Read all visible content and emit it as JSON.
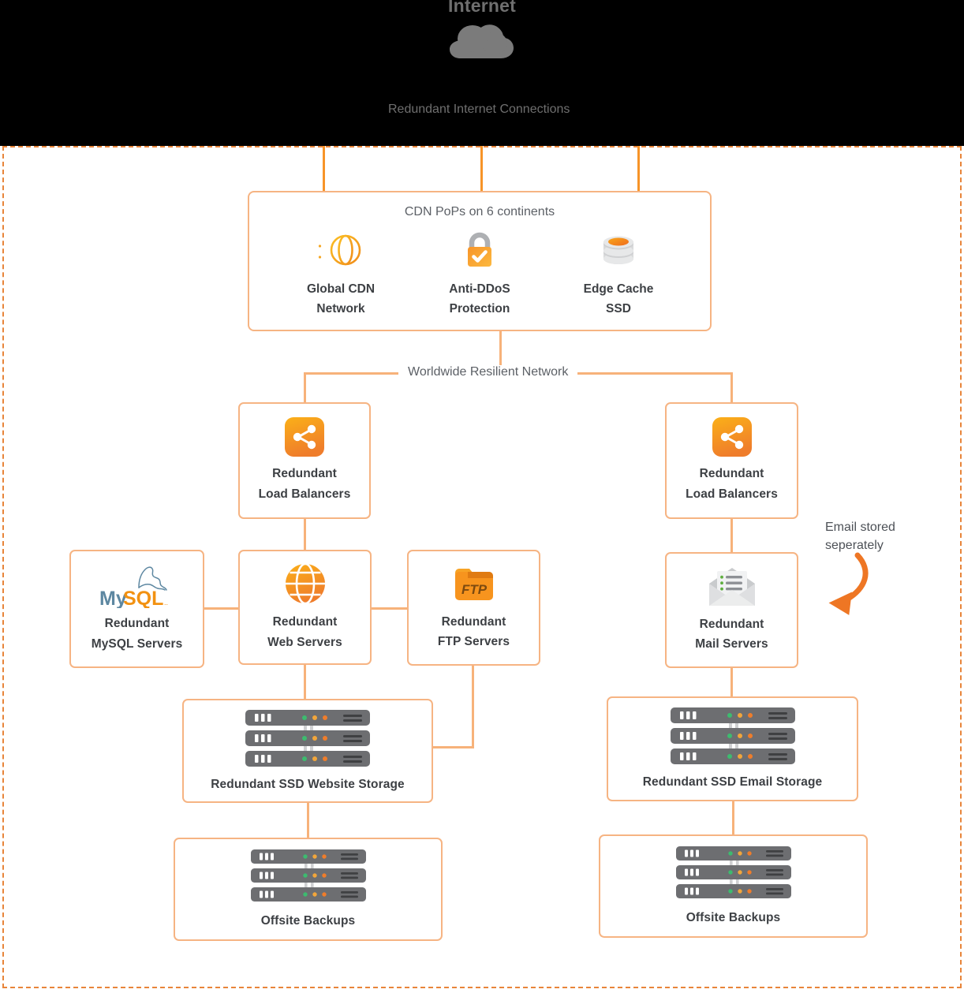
{
  "diagram": {
    "title": "Internet",
    "cloud_icon": "cloud-icon",
    "internet_link_label": "Redundant Internet Connections",
    "network_label": "Worldwide Resilient Network",
    "annotation": {
      "line1": "Email stored",
      "line2": "seperately"
    },
    "colors": {
      "accent": "#f79428",
      "line": "#f7b483",
      "box_border": "#f6b483",
      "band": "#000000",
      "text_dark": "#3d4044",
      "text_muted": "#5c6066",
      "rack_body": "#6d6e71",
      "led_green": "#3dbb6f",
      "led_orange": "#f2a63b",
      "led_red_orange": "#ef7d2b",
      "mysql_blue": "#5d87a1",
      "mysql_orange": "#f29111"
    }
  },
  "cdn_panel": {
    "title": "CDN PoPs on 6 continents",
    "items": [
      {
        "icon": "globe-speed-icon",
        "line1": "Global CDN",
        "line2": "Network"
      },
      {
        "icon": "lock-check-icon",
        "line1": "Anti-DDoS",
        "line2": "Protection"
      },
      {
        "icon": "database-icon",
        "line1": "Edge Cache",
        "line2": "SSD"
      }
    ]
  },
  "nodes": {
    "lb_left": {
      "icon": "share-nodes-icon",
      "line1": "Redundant",
      "line2": "Load Balancers"
    },
    "lb_right": {
      "icon": "share-nodes-icon",
      "line1": "Redundant",
      "line2": "Load Balancers"
    },
    "mysql": {
      "icon": "mysql-logo-icon",
      "line1": "Redundant",
      "line2": "MySQL Servers"
    },
    "web": {
      "icon": "globe-icon",
      "line1": "Redundant",
      "line2": "Web Servers"
    },
    "ftp": {
      "icon": "ftp-folder-icon",
      "line1": "Redundant",
      "line2": "FTP Servers"
    },
    "mail": {
      "icon": "mail-open-icon",
      "line1": "Redundant",
      "line2": "Mail Servers"
    },
    "web_storage": {
      "icon": "server-rack-icon",
      "label": "Redundant SSD Website Storage"
    },
    "mail_storage": {
      "icon": "server-rack-icon",
      "label": "Redundant SSD Email Storage"
    },
    "backup_left": {
      "icon": "server-rack-icon",
      "label": "Offsite Backups"
    },
    "backup_right": {
      "icon": "server-rack-icon",
      "label": "Offsite Backups"
    }
  }
}
